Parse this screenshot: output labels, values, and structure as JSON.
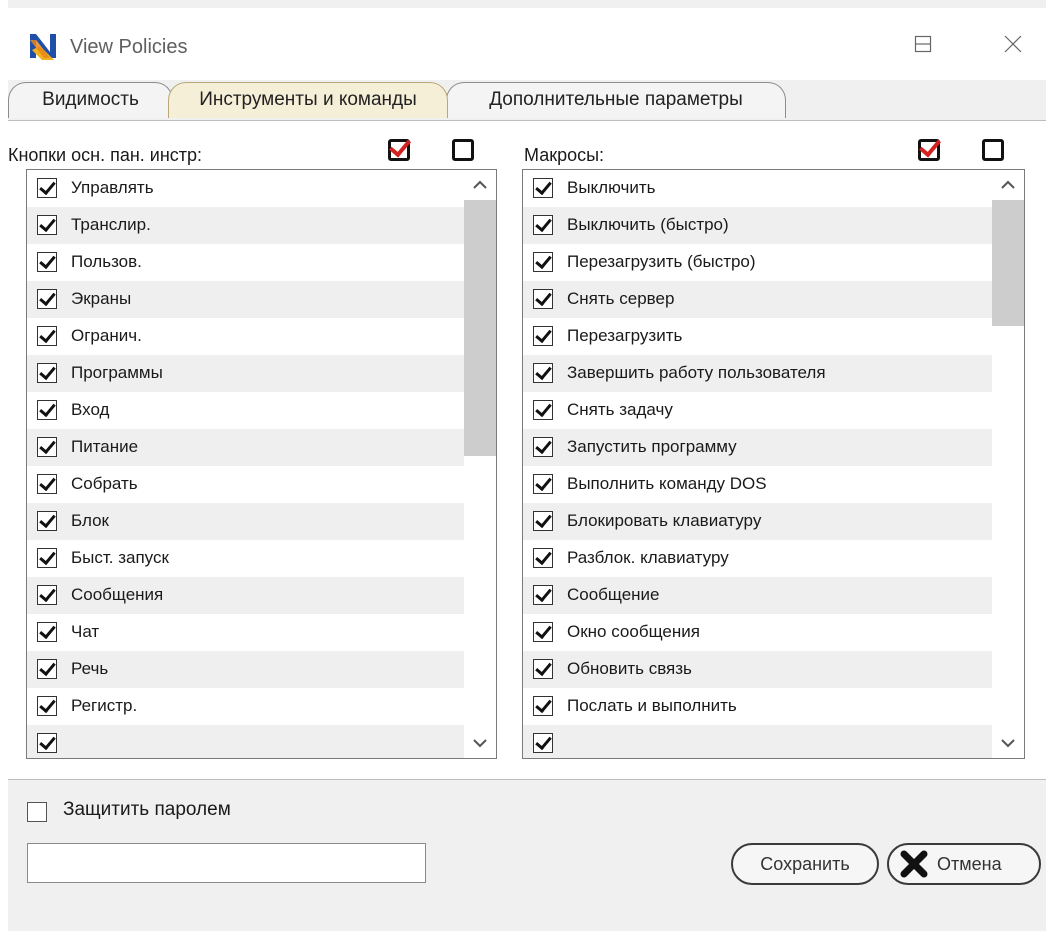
{
  "window": {
    "title": "View Policies",
    "icon": "app-n-logo-icon"
  },
  "tabs": [
    {
      "label": "Видимость",
      "active": false
    },
    {
      "label": "Инструменты и команды",
      "active": true
    },
    {
      "label": "Дополнительные параметры",
      "active": false
    }
  ],
  "left_panel": {
    "label": "Кнопки осн. пан. инстр:",
    "check_all_checked": true,
    "uncheck_all_checked": false,
    "items": [
      {
        "label": "Управлять",
        "checked": true
      },
      {
        "label": "Транслир.",
        "checked": true
      },
      {
        "label": "Пользов.",
        "checked": true
      },
      {
        "label": "Экраны",
        "checked": true
      },
      {
        "label": "Огранич.",
        "checked": true
      },
      {
        "label": "Программы",
        "checked": true
      },
      {
        "label": "Вход",
        "checked": true
      },
      {
        "label": "Питание",
        "checked": true
      },
      {
        "label": "Собрать",
        "checked": true
      },
      {
        "label": "Блок",
        "checked": true
      },
      {
        "label": "Быст. запуск",
        "checked": true
      },
      {
        "label": "Сообщения",
        "checked": true
      },
      {
        "label": "Чат",
        "checked": true
      },
      {
        "label": "Речь",
        "checked": true
      },
      {
        "label": "Регистр.",
        "checked": true
      },
      {
        "label": "",
        "checked": true
      }
    ]
  },
  "right_panel": {
    "label": "Макросы:",
    "check_all_checked": true,
    "uncheck_all_checked": false,
    "items": [
      {
        "label": "Выключить",
        "checked": true
      },
      {
        "label": "Выключить (быстро)",
        "checked": true
      },
      {
        "label": "Перезагрузить (быстро)",
        "checked": true
      },
      {
        "label": "Снять сервер",
        "checked": true
      },
      {
        "label": "Перезагрузить",
        "checked": true
      },
      {
        "label": "Завершить работу пользователя",
        "checked": true
      },
      {
        "label": "Снять задачу",
        "checked": true
      },
      {
        "label": "Запустить программу",
        "checked": true
      },
      {
        "label": "Выполнить команду DOS",
        "checked": true
      },
      {
        "label": "Блокировать клавиатуру",
        "checked": true
      },
      {
        "label": "Разблок. клавиатуру",
        "checked": true
      },
      {
        "label": "Сообщение",
        "checked": true
      },
      {
        "label": "Окно сообщения",
        "checked": true
      },
      {
        "label": "Обновить связь",
        "checked": true
      },
      {
        "label": "Послать и выполнить",
        "checked": true
      },
      {
        "label": "",
        "checked": true
      }
    ]
  },
  "password": {
    "label": "Защитить паролем",
    "checked": false,
    "value": ""
  },
  "buttons": {
    "save": "Сохранить",
    "cancel": "Отмена"
  },
  "colors": {
    "active_tab": "#f5efd8",
    "check_accent": "#d32020",
    "row_alt": "#efefef"
  }
}
